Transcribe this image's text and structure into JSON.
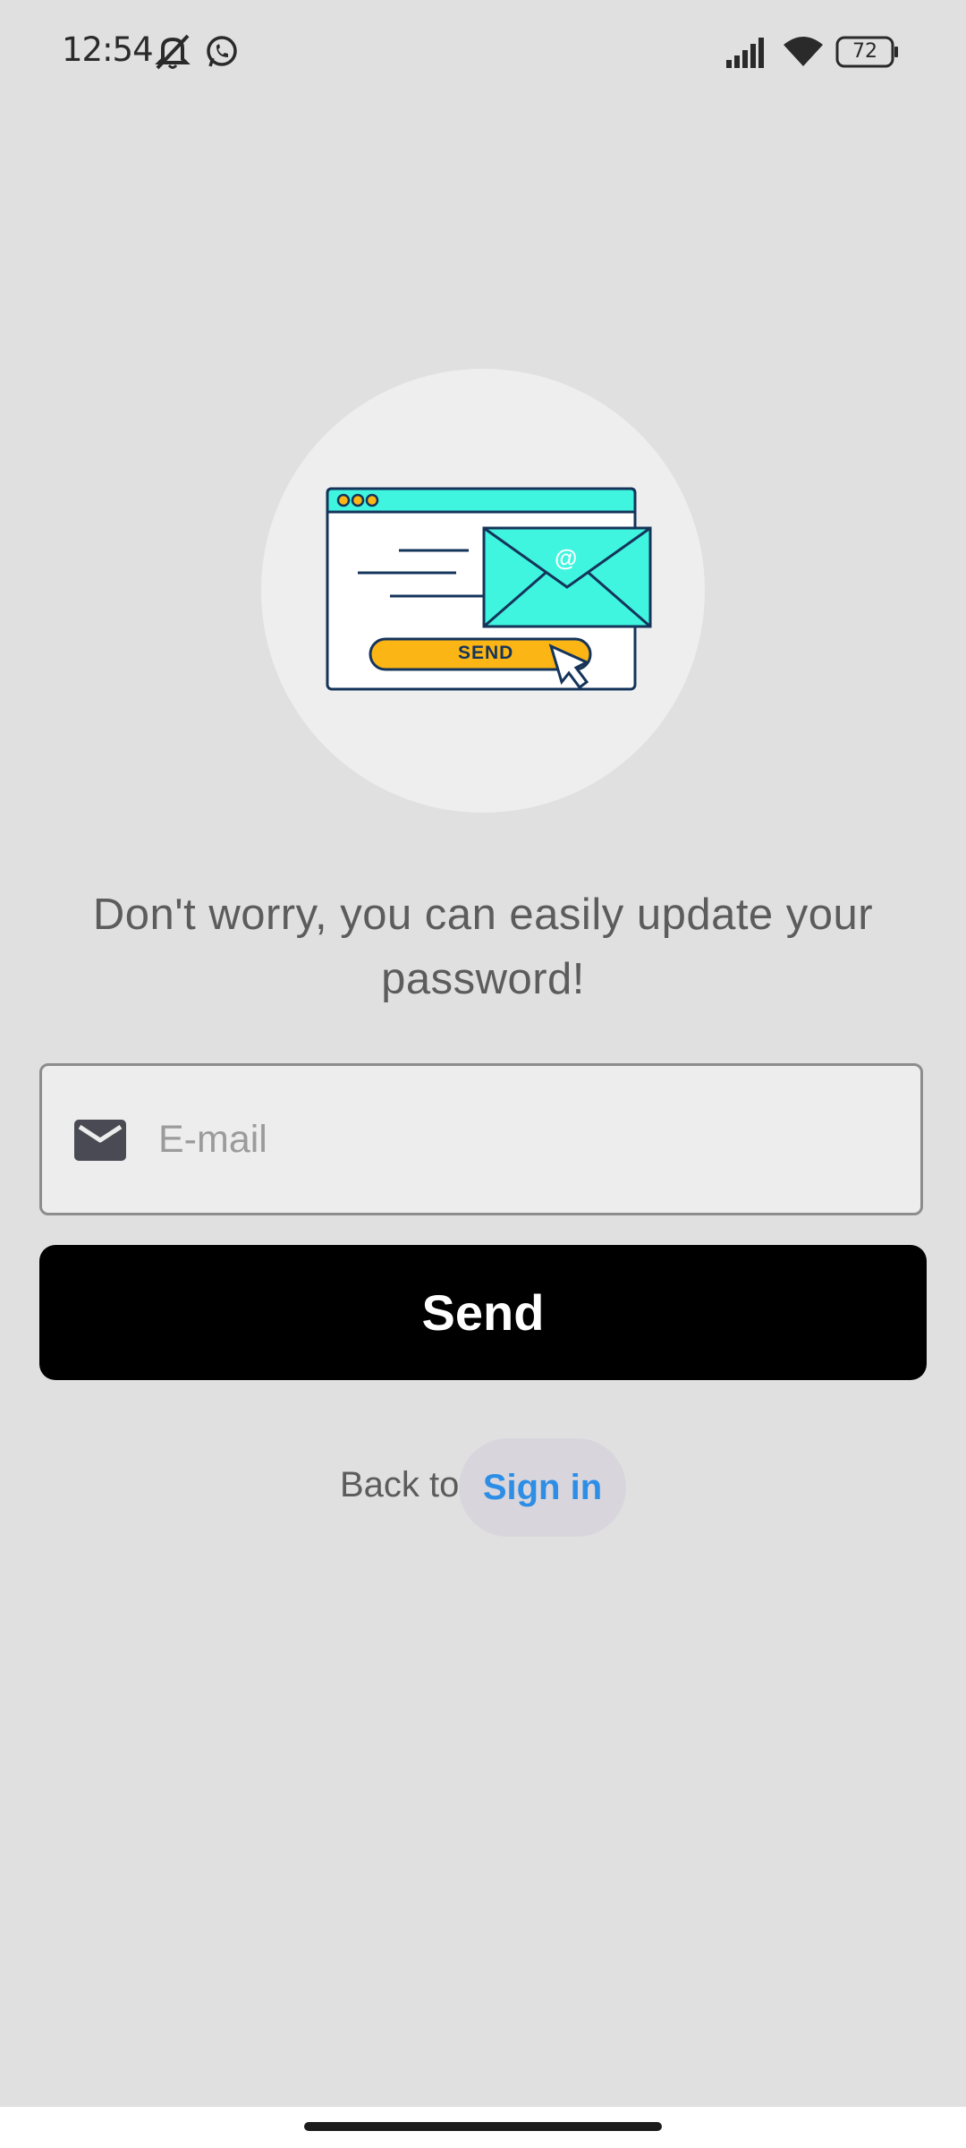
{
  "status_bar": {
    "time": "12:54",
    "battery": "72",
    "icons": [
      "mute-icon",
      "whatsapp-icon",
      "signal-icon",
      "wifi-icon",
      "battery-icon"
    ]
  },
  "illustration": {
    "button_text": "SEND",
    "at_symbol": "@",
    "colors": {
      "window_bar": "#3ff5df",
      "envelope": "#3ff5df",
      "send_button": "#fbb616",
      "outline": "#15345a"
    }
  },
  "message": "Don't worry, you can easily update your password!",
  "email": {
    "placeholder": "E-mail",
    "value": "",
    "icon": "mail-icon"
  },
  "send_button": {
    "label": "Send"
  },
  "back": {
    "prefix": "Back to",
    "link_label": "Sign in",
    "link_color": "#2e8ee6"
  }
}
